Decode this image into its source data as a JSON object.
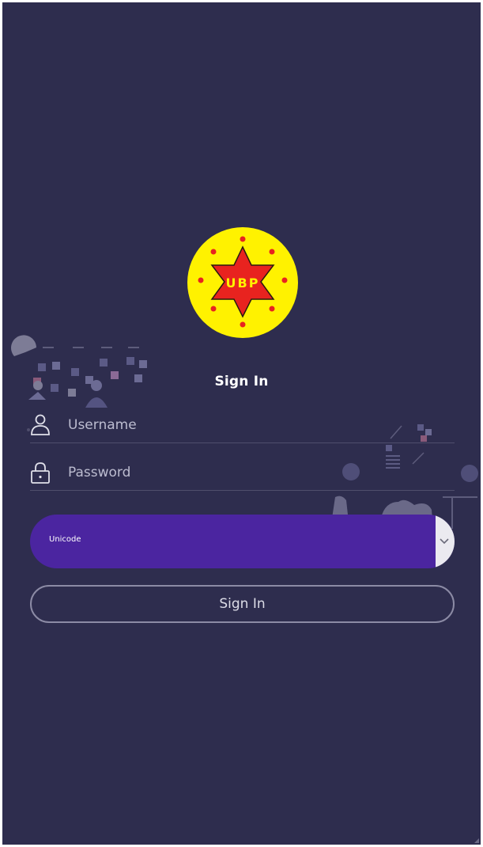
{
  "logo": {
    "text": "UBP",
    "colors": {
      "disc": "#fff200",
      "star": "#e8231f",
      "dots": "#e8231f",
      "text": "#fff200"
    }
  },
  "form": {
    "title": "Sign In",
    "username": {
      "placeholder": "Username",
      "value": "",
      "icon": "user-icon"
    },
    "password": {
      "placeholder": "Password",
      "value": "",
      "icon": "lock-icon"
    },
    "encoding_select": {
      "value": "Unicode",
      "icon": "chevron-down-icon"
    },
    "submit_label": "Sign In"
  },
  "theme": {
    "background": "#2e2d4e",
    "select_background": "#4b25a0",
    "button_border": "#8c8ba5"
  }
}
